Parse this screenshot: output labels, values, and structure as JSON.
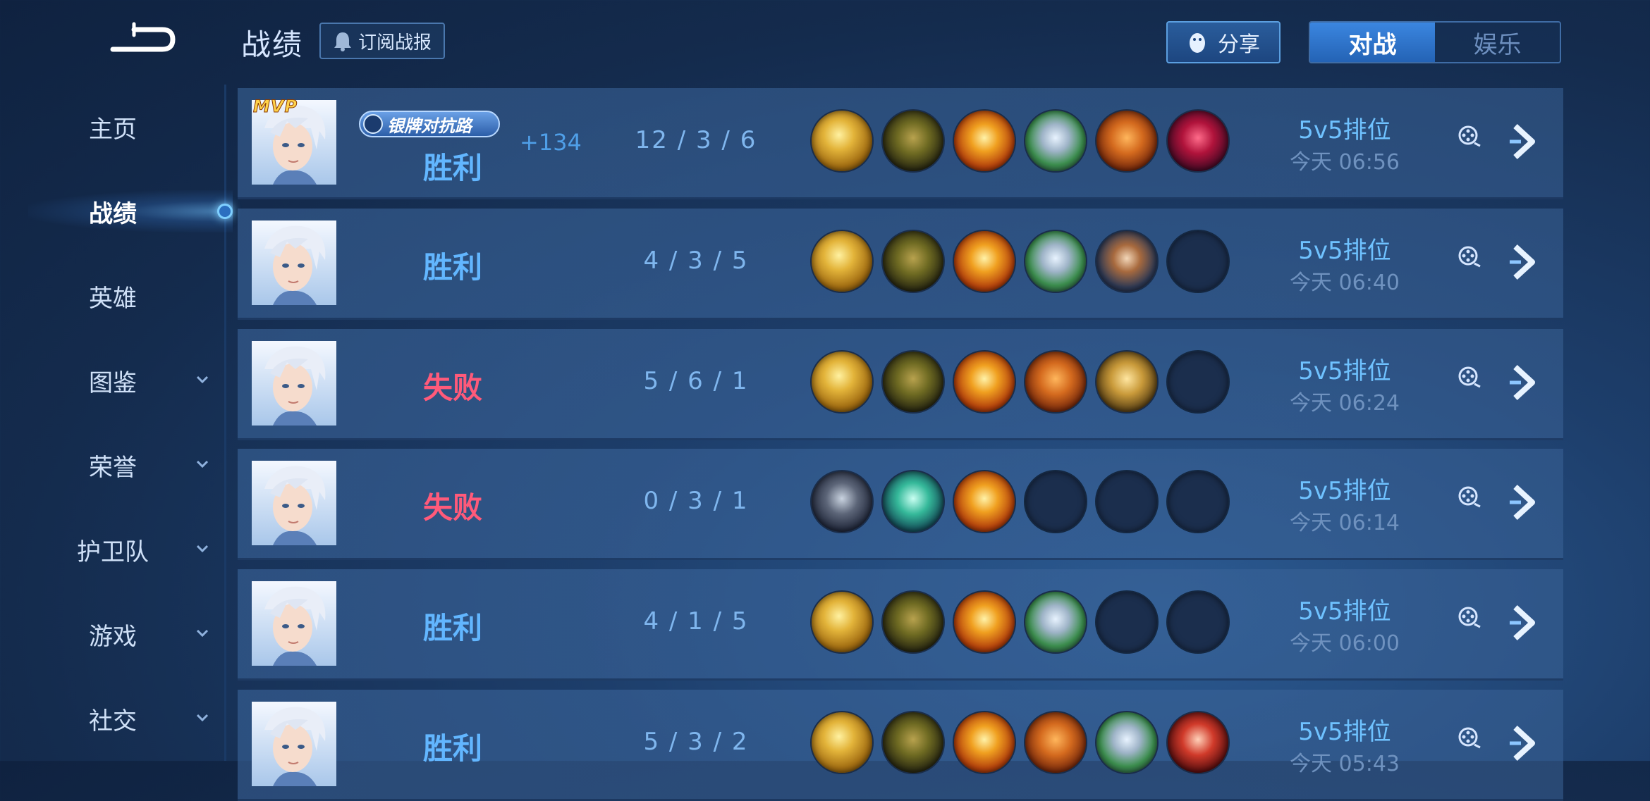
{
  "header": {
    "title": "战绩",
    "subscribe_label": "订阅战报",
    "share_label": "分享",
    "modes": [
      "对战",
      "娱乐"
    ],
    "active_mode": "对战"
  },
  "sidebar": {
    "items": [
      {
        "label": "主页",
        "has_dropdown": false
      },
      {
        "label": "战绩",
        "has_dropdown": false,
        "active": true
      },
      {
        "label": "英雄",
        "has_dropdown": false
      },
      {
        "label": "图鉴",
        "has_dropdown": true
      },
      {
        "label": "荣誉",
        "has_dropdown": true
      },
      {
        "label": "护卫队",
        "has_dropdown": true
      },
      {
        "label": "游戏",
        "has_dropdown": true
      },
      {
        "label": "社交",
        "has_dropdown": true
      }
    ]
  },
  "matches": [
    {
      "mvp": "MVP",
      "badge": "银牌对抗路",
      "result": "胜利",
      "outcome": "win",
      "score": "+134",
      "kda": "12 / 3 / 6",
      "mode": "5v5排位",
      "time": "今天 06:56",
      "items": [
        "gold-orb",
        "green-boots",
        "flame-gauntlet",
        "silver-jade",
        "copper-armor",
        "crimson-claw"
      ]
    },
    {
      "mvp": "",
      "badge": "",
      "result": "胜利",
      "outcome": "win",
      "score": "",
      "kda": "4 / 3 / 5",
      "mode": "5v5排位",
      "time": "今天 06:40",
      "items": [
        "gold-orb",
        "green-boots",
        "flame-gauntlet",
        "silver-jade",
        "steel-armor",
        "empty"
      ]
    },
    {
      "mvp": "",
      "badge": "",
      "result": "失败",
      "outcome": "loss",
      "score": "",
      "kda": "5 / 6 / 1",
      "mode": "5v5排位",
      "time": "今天 06:24",
      "items": [
        "gold-orb",
        "green-boots",
        "flame-gauntlet",
        "copper-armor",
        "gold-robe",
        "empty"
      ]
    },
    {
      "mvp": "",
      "badge": "",
      "result": "失败",
      "outcome": "loss",
      "score": "",
      "kda": "0 / 3 / 1",
      "mode": "5v5排位",
      "time": "今天 06:14",
      "items": [
        "iron-spear",
        "jade-boots",
        "flame-gauntlet",
        "empty",
        "empty",
        "empty"
      ]
    },
    {
      "mvp": "",
      "badge": "",
      "result": "胜利",
      "outcome": "win",
      "score": "",
      "kda": "4 / 1 / 5",
      "mode": "5v5排位",
      "time": "今天 06:00",
      "items": [
        "gold-orb",
        "green-boots",
        "flame-gauntlet",
        "silver-jade",
        "empty",
        "empty"
      ]
    },
    {
      "mvp": "",
      "badge": "",
      "result": "胜利",
      "outcome": "win",
      "score": "",
      "kda": "5 / 3 / 2",
      "mode": "5v5排位",
      "time": "今天 05:43",
      "items": [
        "gold-orb",
        "green-boots",
        "flame-gauntlet",
        "copper-armor",
        "silver-jade",
        "red-blade"
      ]
    }
  ],
  "colors": {
    "win": "#62b6ff",
    "loss": "#ff5a7a",
    "accent": "#3b86e0",
    "background": "#1d3e6b"
  }
}
